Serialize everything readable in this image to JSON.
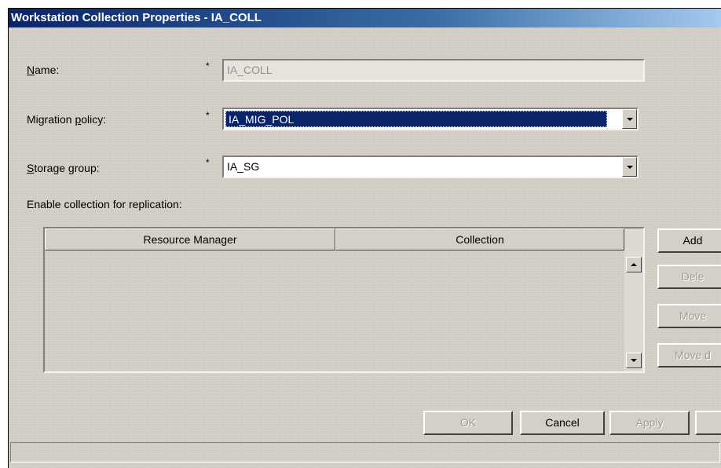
{
  "window": {
    "title": "Workstation Collection Properties - IA_COLL"
  },
  "form": {
    "name": {
      "prefix": "",
      "underlined": "N",
      "suffix": "ame:",
      "required": "*",
      "value": "IA_COLL"
    },
    "migration_policy": {
      "prefix": "Migration ",
      "underlined": "p",
      "suffix": "olicy:",
      "required": "*",
      "value": "IA_MIG_POL"
    },
    "storage_group": {
      "prefix": "",
      "underlined": "S",
      "suffix": "torage group:",
      "required": "*",
      "value": "IA_SG"
    },
    "replication_label": "Enable collection for replication:"
  },
  "table": {
    "columns": [
      "Resource Manager",
      "Collection"
    ],
    "rows": []
  },
  "side_buttons": {
    "add": "Add",
    "delete": "Dele",
    "move_up": "Move",
    "move_down": "Move d"
  },
  "footer_buttons": {
    "ok": "OK",
    "cancel": "Cancel",
    "apply": "Apply"
  }
}
